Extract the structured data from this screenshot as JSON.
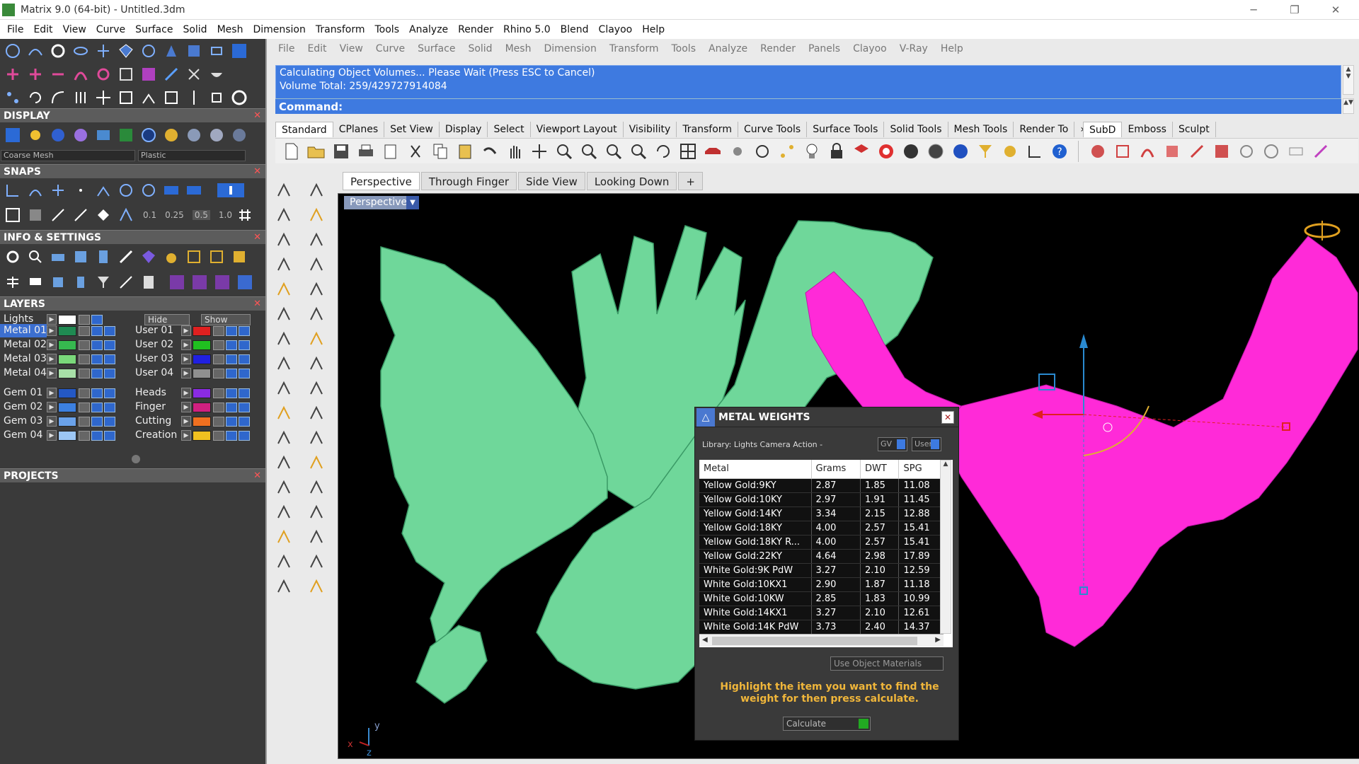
{
  "window": {
    "title": "Matrix 9.0 (64-bit) - Untitled.3dm",
    "minimize": "─",
    "maximize": "❐",
    "close": "✕"
  },
  "menubar": [
    "File",
    "Edit",
    "View",
    "Curve",
    "Surface",
    "Solid",
    "Mesh",
    "Dimension",
    "Transform",
    "Tools",
    "Analyze",
    "Render",
    "Rhino 5.0",
    "Blend",
    "Clayoo",
    "Help"
  ],
  "panel": {
    "display": {
      "title": "DISPLAY",
      "mesh": "Coarse Mesh",
      "material": "Plastic"
    },
    "snaps": {
      "title": "SNAPS",
      "values": [
        "0.1",
        "0.25",
        "0.5",
        "1.0"
      ]
    },
    "info": {
      "title": "INFO & SETTINGS"
    },
    "layers": {
      "title": "LAYERS",
      "lights": "Lights",
      "hide": "Hide",
      "show": "Show",
      "left": [
        {
          "name": "Metal 01",
          "color": "#1f8a52"
        },
        {
          "name": "Metal 02",
          "color": "#36b84f"
        },
        {
          "name": "Metal 03",
          "color": "#7ad87a"
        },
        {
          "name": "Metal 04",
          "color": "#a8e0a8"
        },
        {
          "name": "Gem 01",
          "color": "#2458c4"
        },
        {
          "name": "Gem 02",
          "color": "#3c80e0"
        },
        {
          "name": "Gem 03",
          "color": "#6aa2ea"
        },
        {
          "name": "Gem 04",
          "color": "#9cc6f4"
        }
      ],
      "right": [
        {
          "name": "User 01",
          "color": "#e02020"
        },
        {
          "name": "User 02",
          "color": "#20c020"
        },
        {
          "name": "User 03",
          "color": "#2020e0"
        },
        {
          "name": "User 04",
          "color": "#909090"
        },
        {
          "name": "Heads",
          "color": "#8a2be2"
        },
        {
          "name": "Finger",
          "color": "#d02080"
        },
        {
          "name": "Cutting",
          "color": "#f07020"
        },
        {
          "name": "Creation",
          "color": "#f0c020"
        }
      ]
    },
    "projects": {
      "title": "PROJECTS"
    }
  },
  "rhino": {
    "menu": [
      "File",
      "Edit",
      "View",
      "Curve",
      "Surface",
      "Solid",
      "Mesh",
      "Dimension",
      "Transform",
      "Tools",
      "Analyze",
      "Render",
      "Panels",
      "Clayoo",
      "V-Ray",
      "Help"
    ],
    "command_history": [
      "Calculating Object Volumes... Please Wait (Press ESC to Cancel)",
      "Volume Total: 259/429727914084"
    ],
    "command_label": "Command:",
    "toolbar_tabs": [
      "Standard",
      "CPlanes",
      "Set View",
      "Display",
      "Select",
      "Viewport Layout",
      "Visibility",
      "Transform",
      "Curve Tools",
      "Surface Tools",
      "Solid Tools",
      "Mesh Tools",
      "Render To"
    ],
    "toolbar_tabs_more": "»",
    "toolbar_tabs2": [
      "SubD",
      "Emboss",
      "Sculpt"
    ],
    "viewport_tabs": [
      "Perspective",
      "Through Finger",
      "Side View",
      "Looking Down"
    ],
    "viewport_add": "+",
    "viewport_label": "Perspective",
    "axis": {
      "x": "x",
      "y": "y",
      "z": "z"
    }
  },
  "metal_weights": {
    "title": "METAL WEIGHTS",
    "library": "Library: Lights Camera Action -",
    "gv": "GV",
    "user": "User",
    "columns": [
      "Metal",
      "Grams",
      "DWT",
      "SPG"
    ],
    "rows": [
      [
        "Yellow Gold:9KY",
        "2.87",
        "1.85",
        "11.08"
      ],
      [
        "Yellow Gold:10KY",
        "2.97",
        "1.91",
        "11.45"
      ],
      [
        "Yellow Gold:14KY",
        "3.34",
        "2.15",
        "12.88"
      ],
      [
        "Yellow Gold:18KY",
        "4.00",
        "2.57",
        "15.41"
      ],
      [
        "Yellow Gold:18KY R...",
        "4.00",
        "2.57",
        "15.41"
      ],
      [
        "Yellow Gold:22KY",
        "4.64",
        "2.98",
        "17.89"
      ],
      [
        "White Gold:9K PdW",
        "3.27",
        "2.10",
        "12.59"
      ],
      [
        "White Gold:10KX1",
        "2.90",
        "1.87",
        "11.18"
      ],
      [
        "White Gold:10KW",
        "2.85",
        "1.83",
        "10.99"
      ],
      [
        "White Gold:14KX1",
        "3.27",
        "2.10",
        "12.61"
      ],
      [
        "White Gold:14K PdW",
        "3.73",
        "2.40",
        "14.37"
      ]
    ],
    "use_object_materials": "Use Object Materials",
    "hint": "Highlight the item you want to find the weight for then press calculate.",
    "calculate": "Calculate"
  }
}
